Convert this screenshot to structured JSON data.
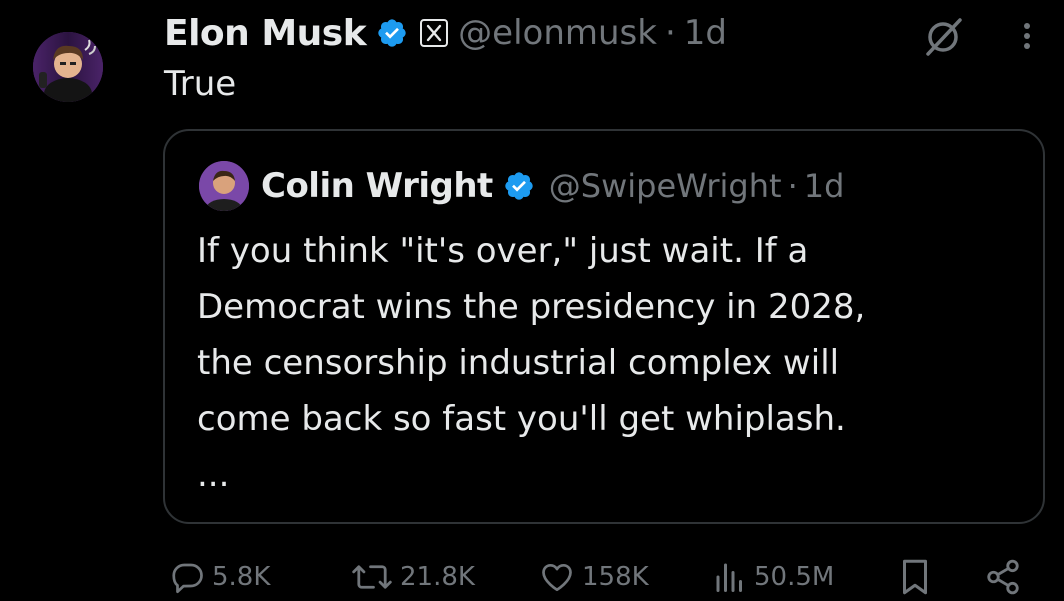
{
  "tweet": {
    "author_name": "Elon Musk",
    "handle": "@elonmusk",
    "separator": "·",
    "time": "1d",
    "text": "True"
  },
  "quoted_tweet": {
    "author_name": "Colin Wright",
    "handle": "@SwipeWright",
    "separator": "·",
    "time": "1d",
    "text_lines": [
      "If you think \"it's over,\" just wait. If a",
      "Democrat wins the presidency in 2028,",
      "the censorship industrial complex will",
      "come back so fast you'll get whiplash.",
      "..."
    ]
  },
  "actions": {
    "replies": "5.8K",
    "reposts": "21.8K",
    "likes": "158K",
    "views": "50.5M"
  },
  "icons": {
    "verified": "verified-badge-icon",
    "affiliate": "x-logo-icon",
    "grok": "grok-icon",
    "more": "more-vertical-icon",
    "reply": "reply-icon",
    "repost": "repost-icon",
    "like": "heart-icon",
    "views": "views-icon",
    "bookmark": "bookmark-icon",
    "share": "share-icon"
  },
  "colors": {
    "background": "#000000",
    "text_primary": "#e7e9ea",
    "text_secondary": "#71767b",
    "verified_blue": "#1d9bf0",
    "border": "#2f3336"
  }
}
